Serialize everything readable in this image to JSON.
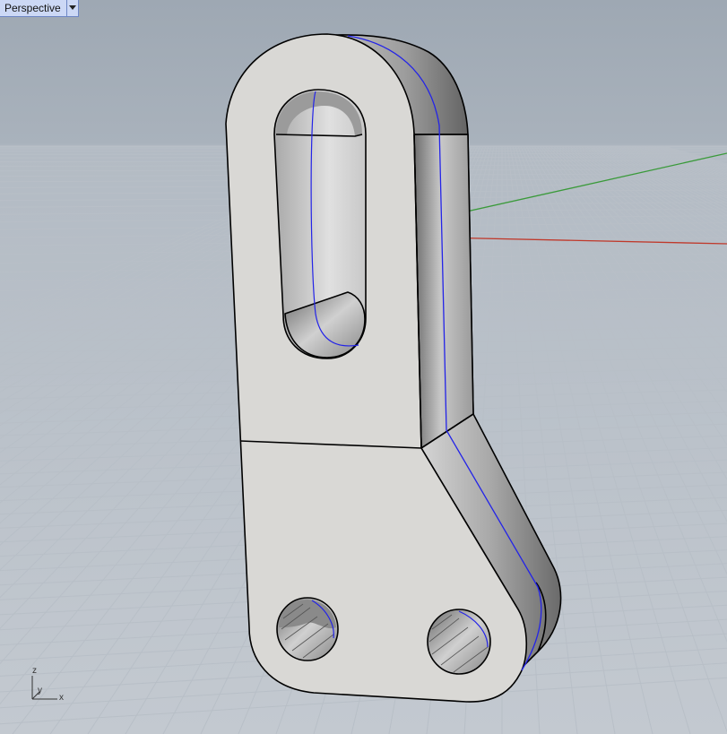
{
  "viewport": {
    "title": "Perspective",
    "menu_icon": "triangle-down-icon"
  },
  "axis_gizmo": {
    "z": "z",
    "y": "y",
    "x": "x"
  },
  "colors": {
    "background_top": "#9ea8b3",
    "background_bottom": "#c3c9d0",
    "grid_line": "#b9c0c8",
    "x_axis": "#c0392b",
    "y_axis": "#3a9a3a",
    "part_face": "#d8d7d4",
    "part_edge": "#000000",
    "seam_line": "#2222ee",
    "tab_background": "#ccd8f5"
  }
}
